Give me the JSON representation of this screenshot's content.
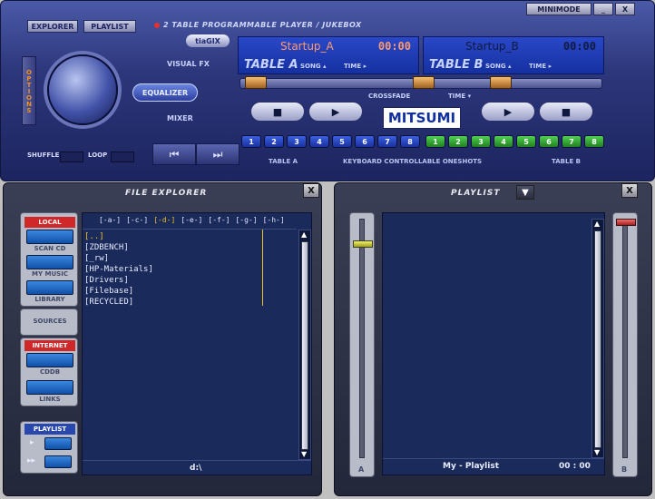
{
  "titlebar": {
    "minimode": "MINIMODE",
    "minimize": "_",
    "close": "X"
  },
  "tabs": {
    "explorer": "EXPLORER",
    "playlist": "PLAYLIST"
  },
  "app_title": "2 TABLE PROGRAMMABLE PLAYER / JUKEBOX",
  "left_controls": {
    "options": "OPTIONS",
    "visual_fx": "VISUAL FX",
    "equalizer": "EQUALIZER",
    "mixer": "MIXER",
    "brand": "tiaGIX",
    "shuffle": "SHUFFLE",
    "loop": "LOOP",
    "prev": "⏮",
    "next": "⏭"
  },
  "table_a": {
    "track": "Startup_A",
    "time": "00:00",
    "label": "TABLE A",
    "song": "SONG ▴",
    "time_lbl": "TIME ▸",
    "footer": "TABLE A"
  },
  "table_b": {
    "track": "Startup_B",
    "time": "00:00",
    "label": "TABLE B",
    "song": "SONG ▴",
    "time_lbl": "TIME ▸",
    "footer": "TABLE B"
  },
  "crossfade": {
    "label": "CROSSFADE",
    "time": "TIME ▾"
  },
  "transport": {
    "stop": "■",
    "play": "▶"
  },
  "mitsumi": "MITSUMI",
  "oneshots": {
    "label": "KEYBOARD CONTROLLABLE ONESHOTS",
    "a": [
      "1",
      "2",
      "3",
      "4",
      "5",
      "6",
      "7",
      "8"
    ],
    "b": [
      "1",
      "2",
      "3",
      "4",
      "5",
      "6",
      "7",
      "8"
    ]
  },
  "explorer": {
    "title": "FILE EXPLORER",
    "close": "X",
    "local": "LOCAL",
    "scan_cd": "SCAN CD",
    "my_music": "MY MUSIC",
    "library": "LIBRARY",
    "sources": "SOURCES",
    "internet": "INTERNET",
    "cddb": "CDDB",
    "links": "LINKS",
    "playlist": "PLAYLIST",
    "drives": [
      "[-a-]",
      "[-c-]",
      "[-d-]",
      "[-e-]",
      "[-f-]",
      "[-g-]",
      "[-h-]"
    ],
    "active_drive": "[-d-]",
    "files": [
      "[..]",
      "[ZDBENCH]",
      "[_rw]",
      "[HP-Materials]",
      "[Drivers]",
      "[Filebase]",
      "[RECYCLED]"
    ],
    "path": "d:\\"
  },
  "playlist_panel": {
    "title": "PLAYLIST",
    "close": "X",
    "status": "My - Playlist",
    "time": "00 : 00",
    "a": "A",
    "b": "B"
  }
}
